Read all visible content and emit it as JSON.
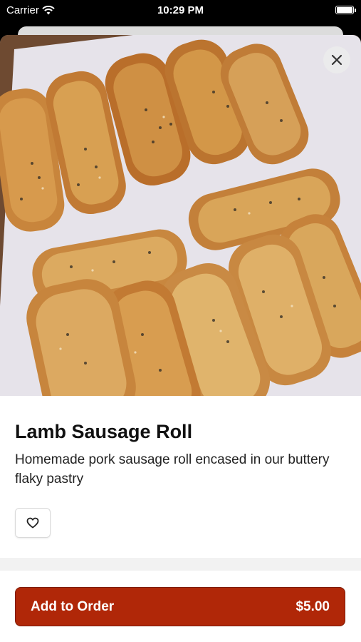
{
  "status_bar": {
    "carrier": "Carrier",
    "time": "10:29 PM"
  },
  "product": {
    "image_icon": "sausage-rolls-photo",
    "title": "Lamb Sausage Roll",
    "description": "Homemade pork sausage roll encased in our buttery flaky pastry"
  },
  "actions": {
    "close_icon": "close-icon",
    "favorite_icon": "heart-icon",
    "add_label": "Add to Order",
    "price": "$5.00"
  },
  "colors": {
    "accent": "#b02708",
    "accent_border": "#7d1a04"
  }
}
